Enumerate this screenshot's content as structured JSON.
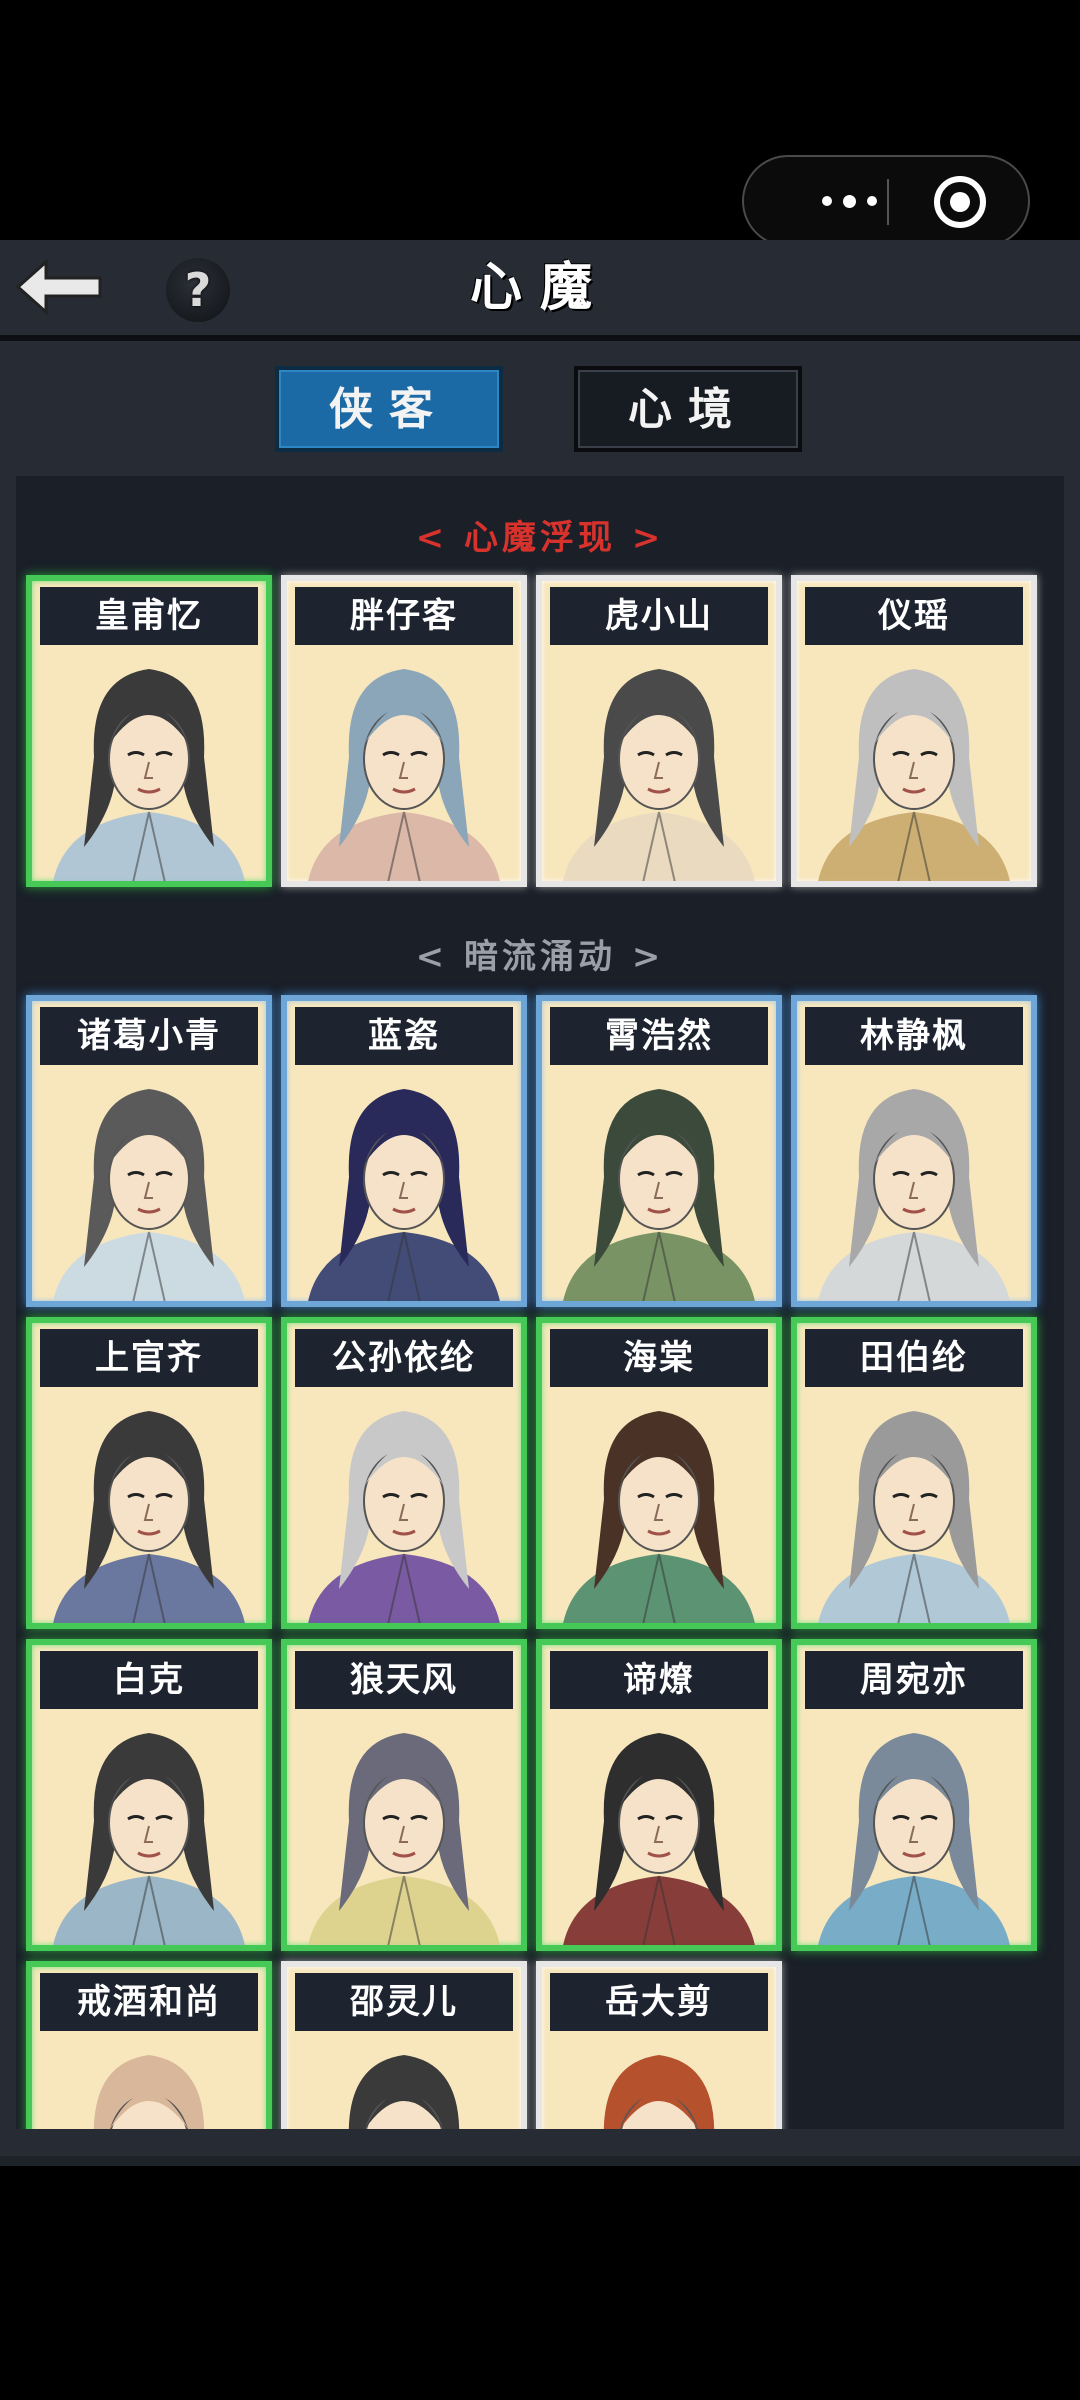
{
  "header": {
    "title": "心魔"
  },
  "tabs": [
    {
      "label": "侠客",
      "active": true
    },
    {
      "label": "心境",
      "active": false
    }
  ],
  "sections": [
    {
      "title": "< 心魔浮现 >",
      "color": "#d8322d"
    },
    {
      "title": "< 暗流涌动 >",
      "color": "#9aa0a8"
    }
  ],
  "cards": [
    {
      "name": "皇甫忆",
      "frame": "green"
    },
    {
      "name": "胖仔客",
      "frame": "white"
    },
    {
      "name": "虎小山",
      "frame": "white"
    },
    {
      "name": "仪瑶",
      "frame": "white"
    },
    {
      "name": "诸葛小青",
      "frame": "blue"
    },
    {
      "name": "蓝瓷",
      "frame": "blue"
    },
    {
      "name": "霄浩然",
      "frame": "blue"
    },
    {
      "name": "林静枫",
      "frame": "blue"
    },
    {
      "name": "上官齐",
      "frame": "green"
    },
    {
      "name": "公孙依纶",
      "frame": "green"
    },
    {
      "name": "海棠",
      "frame": "green"
    },
    {
      "name": "田伯纶",
      "frame": "green"
    },
    {
      "name": "白克",
      "frame": "green"
    },
    {
      "name": "狼天风",
      "frame": "green"
    },
    {
      "name": "谛燎",
      "frame": "green"
    },
    {
      "name": "周宛亦",
      "frame": "green"
    },
    {
      "name": "戒酒和尚",
      "frame": "green"
    },
    {
      "name": "邵灵儿",
      "frame": "white"
    },
    {
      "name": "岳大剪",
      "frame": "white"
    }
  ]
}
